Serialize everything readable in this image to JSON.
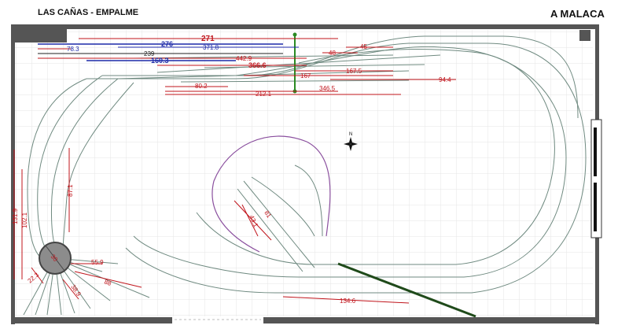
{
  "header": {
    "left_title": "LAS CAÑAS - EMPALME",
    "right_title": "A MALACA"
  },
  "compass": {
    "label": "N"
  },
  "colors": {
    "wall": "#555555",
    "grid": "#e6e6e6",
    "track": "#6f8a80",
    "dim_red": "#c0141b",
    "dim_blue": "#1d2aa8",
    "dim_black": "#222222",
    "loop": "#8a4f9e",
    "marker_green": "#2a8a22",
    "turntable_fill": "#8c8c8c",
    "lever": "#1f4a1a"
  },
  "dimensions": {
    "d271": "271",
    "d276": "276",
    "d78": "78.3",
    "d371": "371.8",
    "d239": "239",
    "d160": "160.3",
    "d442": "442.9",
    "d366": "366.6",
    "d48": "48",
    "d45": "45",
    "d167a": "167.5",
    "d167b": "167",
    "d94": "94.4",
    "d80": "80.2",
    "d346": "346.5",
    "d212": "212.1",
    "d87": "87.1",
    "d131": "131.9",
    "d102": "102.1",
    "d81": "81",
    "d43": "43.1",
    "d55": "55.9",
    "d88": "88",
    "d38": "38.9",
    "d22": "22.3",
    "d30": "30",
    "d134": "134.6"
  }
}
